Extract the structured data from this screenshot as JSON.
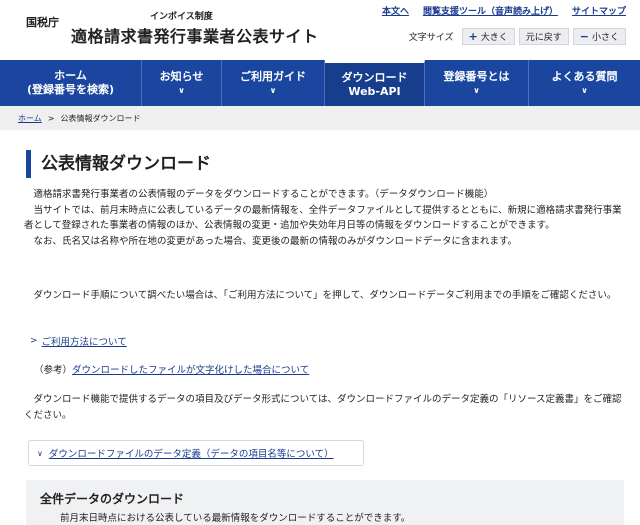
{
  "header": {
    "logo": "国税庁",
    "subtitle": "インボイス制度",
    "site_title": "適格請求書発行事業者公表サイト",
    "top_links": [
      "本文へ",
      "閲覧支援ツール（音声読み上げ）",
      "サイトマップ"
    ],
    "font_size_label": "文字サイズ",
    "font_buttons": [
      {
        "sign": "+",
        "label": "大きく"
      },
      {
        "sign": "",
        "label": "元に戻す"
      },
      {
        "sign": "−",
        "label": "小さく"
      }
    ]
  },
  "nav": {
    "items": [
      {
        "line1": "ホーム",
        "line2": "(登録番号を検索)"
      },
      {
        "line1": "お知らせ",
        "line2": ""
      },
      {
        "line1": "ご利用ガイド",
        "line2": ""
      },
      {
        "line1": "ダウンロード",
        "line2": "Web-API"
      },
      {
        "line1": "登録番号とは",
        "line2": ""
      },
      {
        "line1": "よくある質問",
        "line2": ""
      }
    ],
    "chevron": "∨"
  },
  "breadcrumb": {
    "home": "ホーム",
    "separator": ">",
    "current": "公表情報ダウンロード"
  },
  "main": {
    "title": "公表情報ダウンロード",
    "para1": [
      "適格請求書発行事業者の公表情報のデータをダウンロードすることができます。（データダウンロード機能）",
      "当サイトでは、前月末時点に公表しているデータの最新情報を、全件データファイルとして提供するとともに、新規に適格請求書発行事業者として登録された事業者の情報のほか、公表情報の変更・追加や失効年月日等の情報をダウンロードすることができます。",
      "なお、氏名又は名称や所在地の変更があった場合、変更後の最新の情報のみがダウンロードデータに含まれます。"
    ],
    "para2": "ダウンロード手順について調べたい場合は、「ご利用方法について」を押して、ダウンロードデータご利用までの手順をご確認ください。",
    "link_usage": "ご利用方法について",
    "note_prefix": "（参考）",
    "note_link": "ダウンロードしたファイルが文字化けした場合について",
    "para3": "ダウンロード機能で提供するデータの項目及びデータ形式については、ダウンロードファイルのデータ定義の「リソース定義書」をご確認ください。",
    "accordion_label": "ダウンロードファイルのデータ定義（データの項目名等について）",
    "panel_title": "全件データのダウンロード",
    "panel_desc": "前月末日時点における公表している最新情報をダウンロードすることができます。"
  }
}
